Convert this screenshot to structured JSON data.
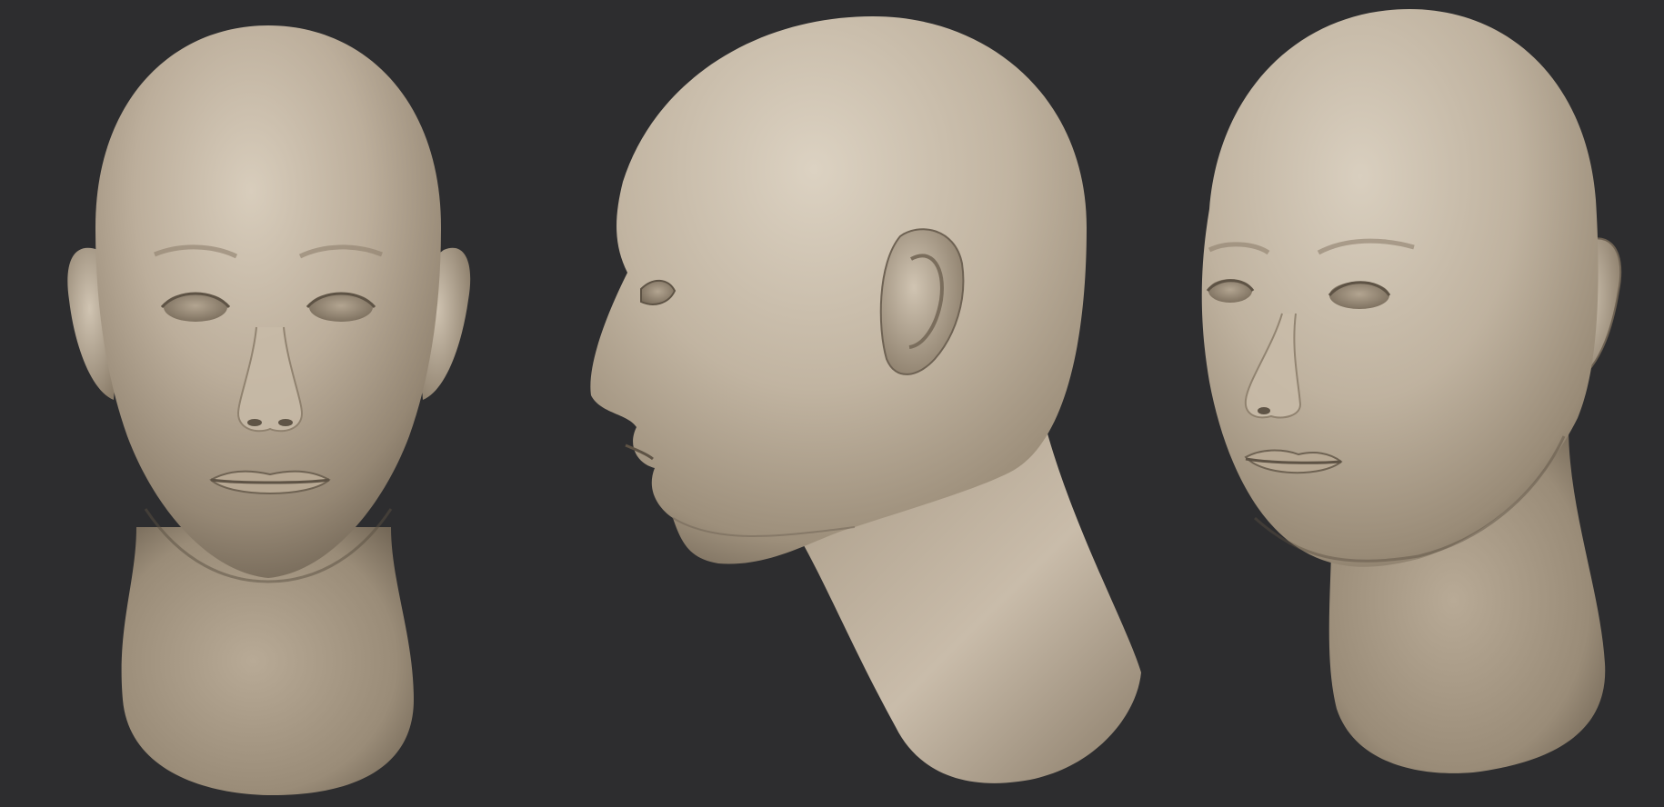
{
  "scene": {
    "background_color": "#2d2d2f",
    "clay_color": "#b2a391",
    "clay_highlight": "#d9cebd",
    "clay_shadow": "#6e6253",
    "views": [
      {
        "name": "front-view",
        "description_icon": "head-front-icon"
      },
      {
        "name": "side-view",
        "description_icon": "head-profile-icon"
      },
      {
        "name": "three-quarter-view",
        "description_icon": "head-three-quarter-icon"
      }
    ]
  }
}
